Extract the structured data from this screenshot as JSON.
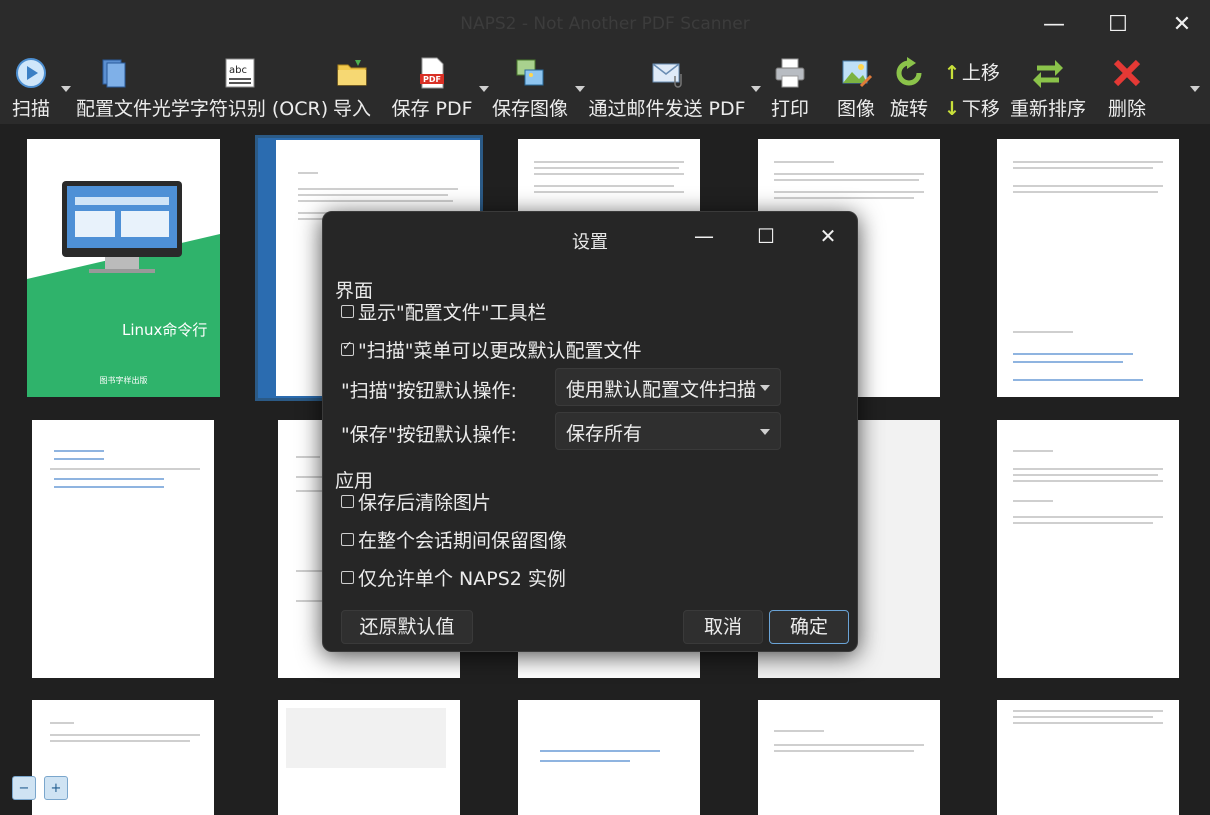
{
  "window": {
    "title": "NAPS2 - Not Another PDF Scanner"
  },
  "toolbar": {
    "scan": "扫描",
    "profiles": "配置文件",
    "ocr": "光学字符识别 (OCR)",
    "import": "导入",
    "save_pdf": "保存 PDF",
    "save_images": "保存图像",
    "email_pdf": "通过邮件发送 PDF",
    "print": "打印",
    "image": "图像",
    "rotate": "旋转",
    "move_up": "上移",
    "move_down": "下移",
    "reorder": "重新排序",
    "delete": "删除"
  },
  "thumbnails": {
    "cover_title": "Linux命令行",
    "cover_publisher": "图书字样出版"
  },
  "settings": {
    "title": "设置",
    "ui_section": "界面",
    "show_profiles_toolbar": "显示\"配置文件\"工具栏",
    "scan_menu_change_default": "\"扫描\"菜单可以更改默认配置文件",
    "scan_button_label": "\"扫描\"按钮默认操作:",
    "scan_button_value": "使用默认配置文件扫描",
    "save_button_label": "\"保存\"按钮默认操作:",
    "save_button_value": "保存所有",
    "app_section": "应用",
    "clear_after_save": "保存后清除图片",
    "keep_images": "在整个会话期间保留图像",
    "single_instance": "仅允许单个 NAPS2 实例",
    "restore_defaults": "还原默认值",
    "cancel": "取消",
    "ok": "确定",
    "checks": {
      "show_profiles_toolbar": false,
      "scan_menu_change_default": true,
      "clear_after_save": false,
      "keep_images": false,
      "single_instance": false
    }
  }
}
